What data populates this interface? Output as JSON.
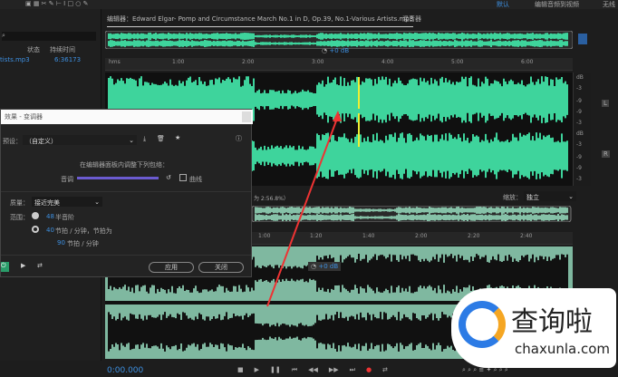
{
  "topbar": {
    "workspace": "默认",
    "workspace_menu": "编辑音频到视频",
    "workspace3": "无线"
  },
  "files": {
    "headers": [
      "状态",
      "持续时间"
    ],
    "rows": [
      {
        "name": "tists.mp3",
        "duration": "6:36173"
      }
    ]
  },
  "editor": {
    "tab": "编辑器：Edward Elgar- Pomp and Circumstance March No.1 in D, Op.39, No.1-Various Artists.mp3",
    "mixer_tab": "混音器",
    "volume": "+0 dB",
    "ruler_top": [
      "hms",
      "1:00",
      "2:00",
      "3:00",
      "4:00",
      "5:00",
      "6:00"
    ],
    "db_labels": [
      "dB",
      "-3",
      "-9",
      "-9",
      "-3",
      "dB",
      "-3",
      "-9",
      "-9",
      "-3"
    ],
    "channels": [
      "L",
      "R"
    ]
  },
  "dialog": {
    "title": "效果 - 变调器",
    "preset_label": "预设：",
    "preset": "（自定义）",
    "hint": "在编辑器面板内调整下列包络：",
    "pitch_label": "音调",
    "curve_label": "曲线",
    "quality_label": "质量：",
    "quality": "接近完美",
    "range_label": "范围：",
    "semitone_value": "48",
    "semitone_label": "半音阶",
    "bpm_value": "40",
    "bpm_label": "节拍 / 分钟，节拍为",
    "beat_value": "90",
    "beat_label": "节拍 / 分钟",
    "apply": "应用",
    "close": "关闭"
  },
  "panel2": {
    "info": "为 2:56.8%）",
    "zoom_label": "缩放：",
    "zoom_value": "独立",
    "ruler": [
      "1:00",
      "1:20",
      "1:40",
      "2:00",
      "2:20",
      "2:40"
    ],
    "volume": "+0 dB"
  },
  "transport": {
    "time": "0:00.000"
  },
  "watermark": {
    "text": "查询啦",
    "url": "chaxunla.com"
  },
  "colors": {
    "wave": "#3ed49c",
    "wave2": "#86c2a8",
    "accent": "#3d8fe0",
    "annotation": "#e33"
  }
}
